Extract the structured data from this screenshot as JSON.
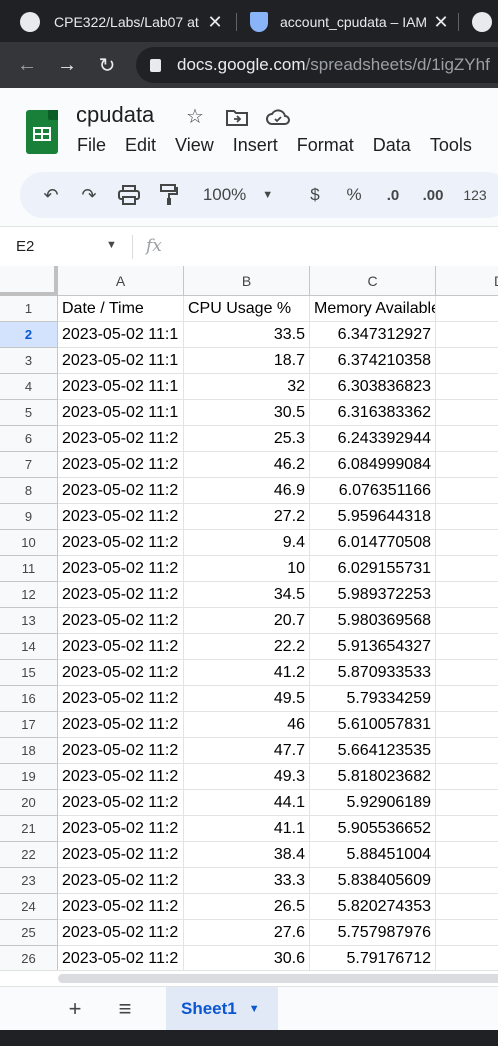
{
  "browser": {
    "tabs": [
      {
        "title": "CPE322/Labs/Lab07 at",
        "icon": "github-icon"
      },
      {
        "title": "account_cpudata – IAM",
        "icon": "shield-icon"
      }
    ],
    "url_host": "docs.google.com",
    "url_path": "/spreadsheets/d/1igZYhf"
  },
  "doc": {
    "title": "cpudata",
    "menu": [
      "File",
      "Edit",
      "View",
      "Insert",
      "Format",
      "Data",
      "Tools"
    ]
  },
  "toolbar": {
    "zoom": "100%",
    "currency": "$",
    "percent": "%",
    "dec_decrease": ".0",
    "dec_increase": ".00",
    "format_more": "123"
  },
  "formula_bar": {
    "cell_ref": "E2",
    "fx": "fx"
  },
  "sheet": {
    "col_headers": [
      "A",
      "B",
      "C",
      "D"
    ],
    "rows": [
      {
        "n": "1",
        "a": "Date / Time",
        "b": "CPU Usage %",
        "c": "Memory Available GB"
      },
      {
        "n": "2",
        "a": "2023-05-02 11:1",
        "b": "33.5",
        "c": "6.347312927"
      },
      {
        "n": "3",
        "a": "2023-05-02 11:1",
        "b": "18.7",
        "c": "6.374210358"
      },
      {
        "n": "4",
        "a": "2023-05-02 11:1",
        "b": "32",
        "c": "6.303836823"
      },
      {
        "n": "5",
        "a": "2023-05-02 11:1",
        "b": "30.5",
        "c": "6.316383362"
      },
      {
        "n": "6",
        "a": "2023-05-02 11:2",
        "b": "25.3",
        "c": "6.243392944"
      },
      {
        "n": "7",
        "a": "2023-05-02 11:2",
        "b": "46.2",
        "c": "6.084999084"
      },
      {
        "n": "8",
        "a": "2023-05-02 11:2",
        "b": "46.9",
        "c": "6.076351166"
      },
      {
        "n": "9",
        "a": "2023-05-02 11:2",
        "b": "27.2",
        "c": "5.959644318"
      },
      {
        "n": "10",
        "a": "2023-05-02 11:2",
        "b": "9.4",
        "c": "6.014770508"
      },
      {
        "n": "11",
        "a": "2023-05-02 11:2",
        "b": "10",
        "c": "6.029155731"
      },
      {
        "n": "12",
        "a": "2023-05-02 11:2",
        "b": "34.5",
        "c": "5.989372253"
      },
      {
        "n": "13",
        "a": "2023-05-02 11:2",
        "b": "20.7",
        "c": "5.980369568"
      },
      {
        "n": "14",
        "a": "2023-05-02 11:2",
        "b": "22.2",
        "c": "5.913654327"
      },
      {
        "n": "15",
        "a": "2023-05-02 11:2",
        "b": "41.2",
        "c": "5.870933533"
      },
      {
        "n": "16",
        "a": "2023-05-02 11:2",
        "b": "49.5",
        "c": "5.79334259"
      },
      {
        "n": "17",
        "a": "2023-05-02 11:2",
        "b": "46",
        "c": "5.610057831"
      },
      {
        "n": "18",
        "a": "2023-05-02 11:2",
        "b": "47.7",
        "c": "5.664123535"
      },
      {
        "n": "19",
        "a": "2023-05-02 11:2",
        "b": "49.3",
        "c": "5.818023682"
      },
      {
        "n": "20",
        "a": "2023-05-02 11:2",
        "b": "44.1",
        "c": "5.92906189"
      },
      {
        "n": "21",
        "a": "2023-05-02 11:2",
        "b": "41.1",
        "c": "5.905536652"
      },
      {
        "n": "22",
        "a": "2023-05-02 11:2",
        "b": "38.4",
        "c": "5.88451004"
      },
      {
        "n": "23",
        "a": "2023-05-02 11:2",
        "b": "33.3",
        "c": "5.838405609"
      },
      {
        "n": "24",
        "a": "2023-05-02 11:2",
        "b": "26.5",
        "c": "5.820274353"
      },
      {
        "n": "25",
        "a": "2023-05-02 11:2",
        "b": "27.6",
        "c": "5.757987976"
      },
      {
        "n": "26",
        "a": "2023-05-02 11:2",
        "b": "30.6",
        "c": "5.79176712"
      }
    ]
  },
  "sheet_tabs": {
    "active": "Sheet1"
  },
  "colors": {
    "accent": "#0b57d0",
    "sheets_green": "#188038",
    "active_row_header": "#d3e3fd"
  }
}
